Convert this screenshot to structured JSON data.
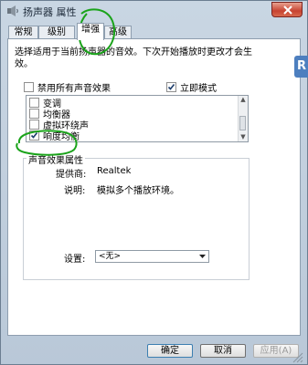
{
  "window": {
    "title": "扬声器 属性"
  },
  "tabs": [
    {
      "label": "常规"
    },
    {
      "label": "级别"
    },
    {
      "label": "增强"
    },
    {
      "label": "高级"
    }
  ],
  "enhancements": {
    "description": "选择适用于当前扬声器的音效。下次开始播放时更改才会生效。",
    "disable_all_label": "禁用所有声音效果",
    "disable_all_checked": false,
    "immediate_mode_label": "立即模式",
    "immediate_mode_checked": true,
    "items": [
      {
        "label": "变调",
        "checked": false
      },
      {
        "label": "均衡器",
        "checked": false
      },
      {
        "label": "虚拟环绕声",
        "checked": false
      },
      {
        "label": "响度均衡",
        "checked": true
      }
    ]
  },
  "properties": {
    "legend": "声音效果属性",
    "provider_label": "提供商:",
    "provider_value": "Realtek",
    "description_label": "说明:",
    "description_value": "模拟多个播放环境。",
    "setting_label": "设置:",
    "setting_value": "<无>"
  },
  "buttons": {
    "ok": "确定",
    "cancel": "取消",
    "apply": "应用(A)"
  },
  "side_badge": "R",
  "colors": {
    "annotation": "#1aa31a",
    "close_button": "#c74331",
    "side_badge": "#4d7fbf"
  }
}
